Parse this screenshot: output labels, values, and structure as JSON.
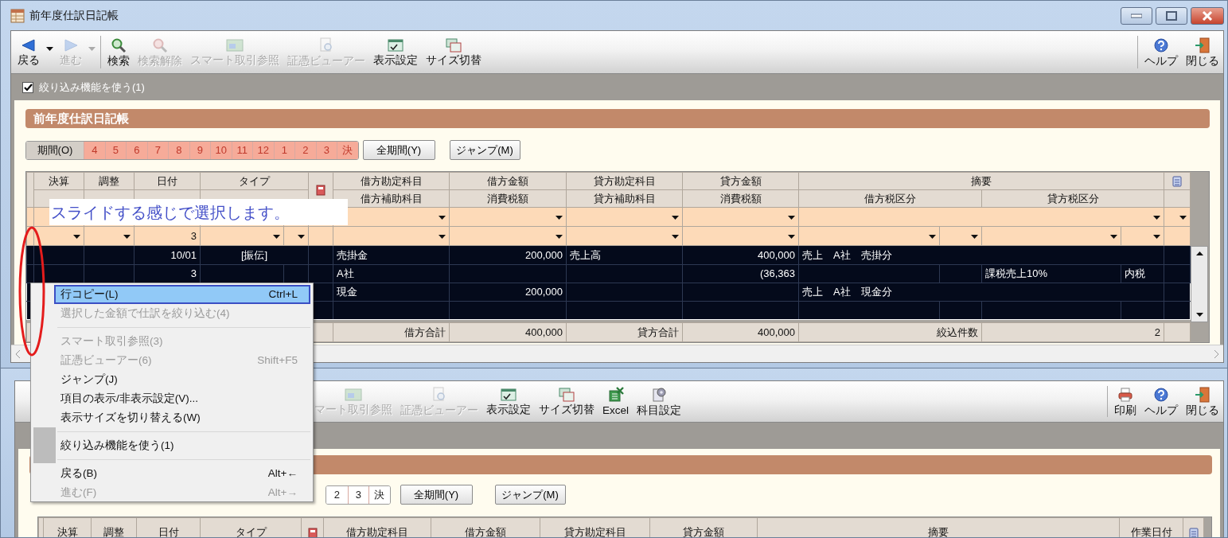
{
  "main_window": {
    "title": "前年度仕訳日記帳",
    "toolbar": [
      {
        "label": "戻る",
        "kind": "back",
        "enabled": true,
        "dropdown": true
      },
      {
        "label": "進む",
        "kind": "forward",
        "enabled": false,
        "dropdown": true
      },
      {
        "label": "検索",
        "kind": "search",
        "enabled": true,
        "dropdown": false
      },
      {
        "label": "検索解除",
        "kind": "clear",
        "enabled": false,
        "dropdown": false
      },
      {
        "label": "スマート取引参照",
        "kind": "smart",
        "enabled": false,
        "dropdown": false
      },
      {
        "label": "証憑ビューアー",
        "kind": "voucher",
        "enabled": false,
        "dropdown": false
      },
      {
        "label": "表示設定",
        "kind": "display",
        "enabled": true,
        "dropdown": false
      },
      {
        "label": "サイズ切替",
        "kind": "size",
        "enabled": true,
        "dropdown": false
      }
    ],
    "toolbar_right": [
      {
        "label": "ヘルプ",
        "kind": "help",
        "enabled": true
      },
      {
        "label": "閉じる",
        "kind": "exit",
        "enabled": true
      }
    ],
    "filter_toggle": {
      "label": "絞り込み機能を使う(1)",
      "checked": true
    },
    "panel_title": "前年度仕訳日記帳",
    "period": {
      "label": "期間(O)",
      "months": [
        {
          "label": "4",
          "selected": true
        },
        {
          "label": "5",
          "selected": true
        },
        {
          "label": "6",
          "selected": true
        },
        {
          "label": "7",
          "selected": true
        },
        {
          "label": "8",
          "selected": true
        },
        {
          "label": "9",
          "selected": true
        },
        {
          "label": "10",
          "selected": true
        },
        {
          "label": "11",
          "selected": true
        },
        {
          "label": "12",
          "selected": true
        },
        {
          "label": "1",
          "selected": true
        },
        {
          "label": "2",
          "selected": true
        },
        {
          "label": "3",
          "selected": true
        },
        {
          "label": "決",
          "selected": true
        }
      ]
    },
    "period_buttons": [
      "全期間(Y)",
      "ジャンプ(M)"
    ],
    "table": {
      "header_top": [
        "決算",
        "調整",
        "日付",
        "タイプ",
        "借方勘定科目",
        "借方金額",
        "貸方勘定科目",
        "貸方金額",
        "摘要"
      ],
      "header_bottom": [
        "借方補助科目",
        "消費税額",
        "貸方補助科目",
        "消費税額",
        "借方税区分",
        "貸方税区分"
      ],
      "filter_voucher_no": "3",
      "entries": [
        {
          "date": "10/01",
          "voucher_no": "3",
          "type": "[振伝]",
          "debit_account": "売掛金",
          "debit_sub": "A社",
          "debit_amount": "200,000",
          "credit_account": "売上高",
          "credit_amount": "400,000",
          "credit_tax": "(36,363",
          "memo": "売上　A社　売掛分",
          "credit_tax_class": "課税売上10%",
          "credit_tax_mode": "内税",
          "selected": true,
          "focused": false
        },
        {
          "debit_account": "現金",
          "debit_amount": "200,000",
          "memo": "売上　A社　現金分",
          "selected": true,
          "focused": true
        }
      ],
      "totals": [
        {
          "label": "借方合計",
          "value": "400,000"
        },
        {
          "label": "貸方合計",
          "value": "400,000"
        },
        {
          "label": "絞込件数",
          "value": "2"
        }
      ]
    }
  },
  "back_window": {
    "toolbar": [
      {
        "label": "マート取引参照",
        "kind": "smart",
        "enabled": false
      },
      {
        "label": "証憑ビューアー",
        "kind": "voucher",
        "enabled": false
      },
      {
        "label": "表示設定",
        "kind": "display",
        "enabled": true
      },
      {
        "label": "サイズ切替",
        "kind": "size",
        "enabled": true
      },
      {
        "label": "Excel",
        "kind": "excel",
        "enabled": true
      },
      {
        "label": "科目設定",
        "kind": "accounts",
        "enabled": true
      }
    ],
    "toolbar_right": [
      {
        "label": "印刷",
        "kind": "print",
        "enabled": true
      },
      {
        "label": "ヘルプ",
        "kind": "help",
        "enabled": true
      },
      {
        "label": "閉じる",
        "kind": "exit",
        "enabled": true
      }
    ],
    "period": {
      "months": [
        {
          "label": "2",
          "selected": false
        },
        {
          "label": "3",
          "selected": false
        },
        {
          "label": "決",
          "selected": false
        }
      ]
    },
    "period_buttons": [
      "全期間(Y)",
      "ジャンプ(M)"
    ],
    "table_header": [
      "決算",
      "調整",
      "日付",
      "タイプ",
      "借方勘定科目",
      "借方金額",
      "貸方勘定科目",
      "貸方金額",
      "摘要",
      "作業日付"
    ]
  },
  "context_menu": {
    "items": [
      {
        "kind": "item",
        "label": "行コピー(L)",
        "shortcut": "Ctrl+L",
        "enabled": true,
        "selected": true,
        "checked": false
      },
      {
        "kind": "item",
        "label": "選択した金額で仕訳を絞り込む(4)",
        "enabled": false,
        "selected": false,
        "checked": false
      },
      {
        "kind": "separator"
      },
      {
        "kind": "item",
        "label": "スマート取引参照(3)",
        "enabled": false,
        "selected": false,
        "checked": false
      },
      {
        "kind": "item",
        "label": "証憑ビューアー(6)",
        "shortcut": "Shift+F5",
        "enabled": false,
        "selected": false,
        "checked": false
      },
      {
        "kind": "item",
        "label": "ジャンプ(J)",
        "enabled": true,
        "selected": false,
        "checked": false
      },
      {
        "kind": "item",
        "label": "項目の表示/非表示設定(V)...",
        "enabled": true,
        "selected": false,
        "checked": false
      },
      {
        "kind": "item",
        "label": "表示サイズを切り替える(W)",
        "enabled": true,
        "selected": false,
        "checked": false
      },
      {
        "kind": "separator"
      },
      {
        "kind": "item",
        "label": "絞り込み機能を使う(1)",
        "enabled": true,
        "selected": false,
        "checked": true
      },
      {
        "kind": "separator"
      },
      {
        "kind": "item",
        "label": "戻る(B)",
        "shortcut": "Alt+←",
        "enabled": true,
        "selected": false,
        "checked": false
      },
      {
        "kind": "item",
        "label": "進む(F)",
        "shortcut": "Alt+→",
        "enabled": false,
        "selected": false,
        "checked": false
      }
    ]
  },
  "annotation": {
    "note": "スライドする感じで選択します。"
  }
}
